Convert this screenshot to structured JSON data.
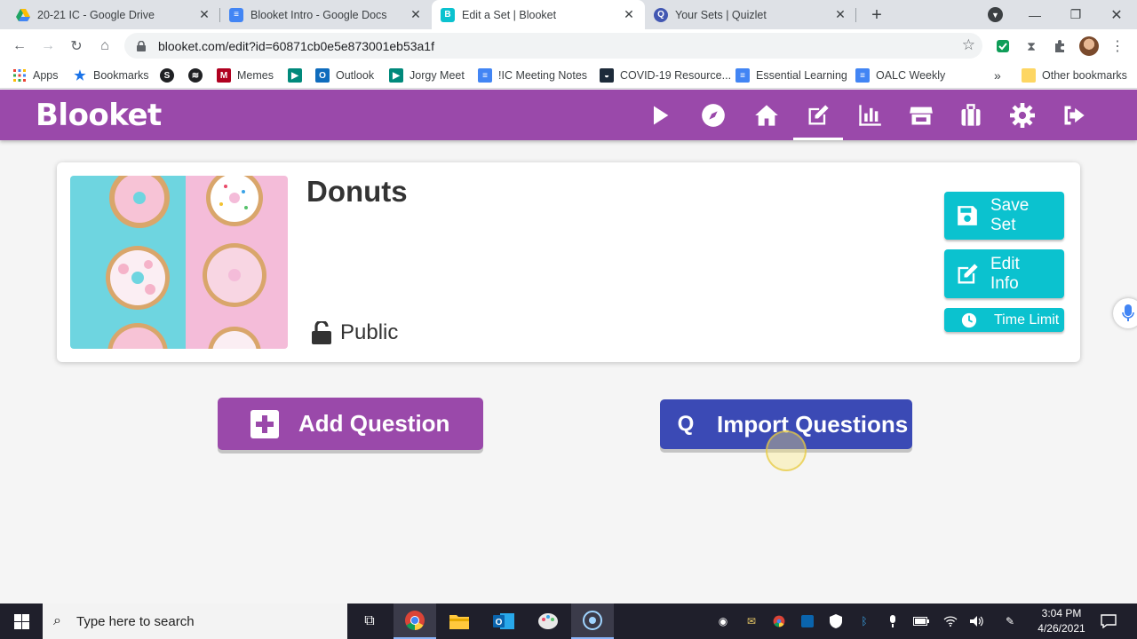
{
  "browser": {
    "tabs": [
      {
        "title": "20-21 IC - Google Drive",
        "icon": "google-drive-icon"
      },
      {
        "title": "Blooket Intro - Google Docs",
        "icon": "google-docs-icon"
      },
      {
        "title": "Edit a Set | Blooket",
        "icon": "blooket-icon",
        "active": true
      },
      {
        "title": "Your Sets | Quizlet",
        "icon": "quizlet-icon"
      }
    ],
    "url": "blooket.com/edit?id=60871cb0e5e873001eb53a1f",
    "bookmarks": [
      {
        "label": "Apps"
      },
      {
        "label": "Bookmarks"
      },
      {
        "label": ""
      },
      {
        "label": ""
      },
      {
        "label": "Memes"
      },
      {
        "label": ""
      },
      {
        "label": "Outlook"
      },
      {
        "label": "Jorgy Meet"
      },
      {
        "label": "!IC Meeting Notes"
      },
      {
        "label": "COVID-19 Resource..."
      },
      {
        "label": "Essential Learning"
      },
      {
        "label": "OALC Weekly"
      }
    ],
    "bookmarks_overflow": "»",
    "other_bookmarks": "Other bookmarks"
  },
  "app": {
    "logo": "Blooket",
    "brand_color": "#9a49aa",
    "accent_color": "#0bc2cf",
    "nav": [
      "play-icon",
      "discover-icon",
      "home-icon",
      "edit-icon",
      "stats-icon",
      "market-icon",
      "blooks-icon",
      "settings-icon",
      "logout-icon"
    ],
    "active_nav": "edit-icon"
  },
  "set": {
    "title": "Donuts",
    "privacy": "Public",
    "save_label_1": "Save",
    "save_label_2": "Set",
    "edit_label_1": "Edit",
    "edit_label_2": "Info",
    "time_limit_label": "Time Limit"
  },
  "actions": {
    "add_question": "Add Question",
    "import_questions": "Import Questions"
  },
  "taskbar": {
    "search_placeholder": "Type here to search",
    "time": "3:04 PM",
    "date": "4/26/2021"
  }
}
